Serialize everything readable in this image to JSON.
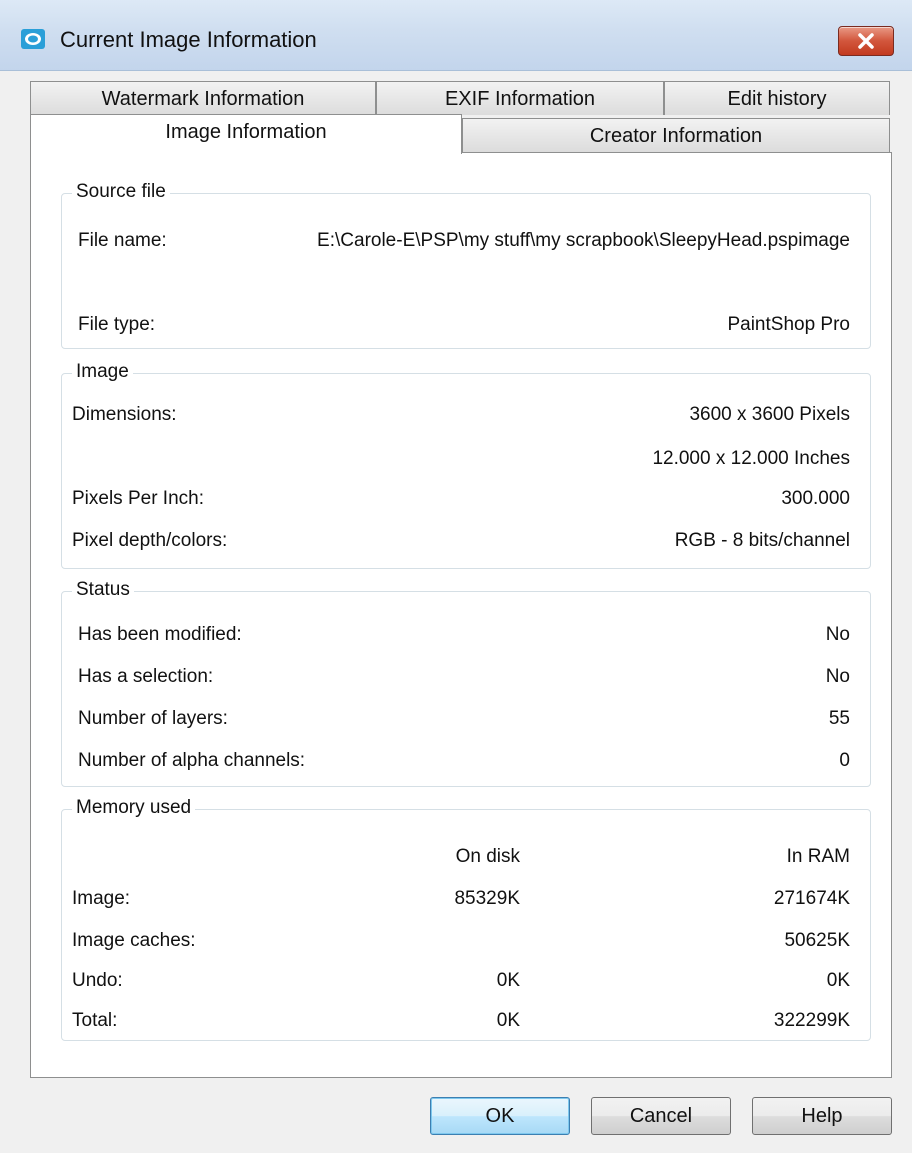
{
  "window": {
    "title": "Current Image Information"
  },
  "tabs": {
    "back": [
      "Watermark Information",
      "EXIF Information",
      "Edit history"
    ],
    "front": [
      "Image Information",
      "Creator Information"
    ]
  },
  "source_file": {
    "title": "Source file",
    "file_name_label": "File name:",
    "file_name_value": "E:\\Carole-E\\PSP\\my stuff\\my scrapbook\\SleepyHead.pspimage",
    "file_type_label": "File type:",
    "file_type_value": "PaintShop Pro"
  },
  "image": {
    "title": "Image",
    "dimensions_label": "Dimensions:",
    "dimensions_pixels": "3600 x 3600 Pixels",
    "dimensions_inches": "12.000 x 12.000 Inches",
    "ppi_label": "Pixels Per Inch:",
    "ppi_value": "300.000",
    "depth_label": "Pixel depth/colors:",
    "depth_value": "RGB - 8 bits/channel"
  },
  "status": {
    "title": "Status",
    "rows": [
      {
        "label": "Has been modified:",
        "value": "No"
      },
      {
        "label": "Has a selection:",
        "value": "No"
      },
      {
        "label": "Number of layers:",
        "value": "55"
      },
      {
        "label": "Number of alpha channels:",
        "value": "0"
      }
    ]
  },
  "memory": {
    "title": "Memory used",
    "col_disk": "On disk",
    "col_ram": "In RAM",
    "rows": [
      {
        "label": "Image:",
        "disk": "85329K",
        "ram": "271674K"
      },
      {
        "label": "Image caches:",
        "disk": "",
        "ram": "50625K"
      },
      {
        "label": "Undo:",
        "disk": "0K",
        "ram": "0K"
      },
      {
        "label": "Total:",
        "disk": "0K",
        "ram": "322299K"
      }
    ]
  },
  "buttons": {
    "ok": "OK",
    "cancel": "Cancel",
    "help": "Help"
  },
  "colors": {
    "titlebar": "#cfdef0",
    "close": "#c23a1f",
    "default_button": "#bee6fd"
  },
  "icons": {
    "app": "paintshop-icon",
    "close": "close-icon"
  }
}
